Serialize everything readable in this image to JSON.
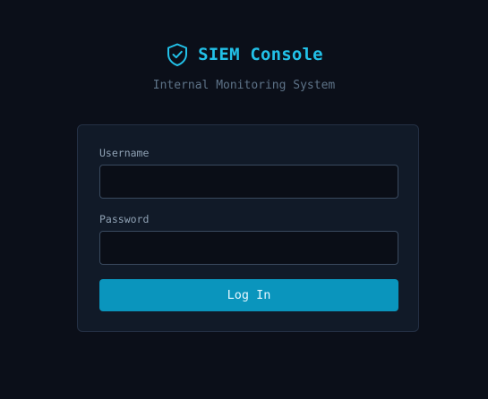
{
  "header": {
    "title": "SIEM Console",
    "subtitle": "Internal Monitoring System",
    "icon": "shield-check-icon"
  },
  "login_form": {
    "username_label": "Username",
    "username_value": "",
    "username_placeholder": "",
    "password_label": "Password",
    "password_value": "",
    "password_placeholder": "",
    "submit_label": "Log In"
  },
  "colors": {
    "background": "#0b0f19",
    "card": "#111a28",
    "accent": "#22c1e8",
    "button": "#0a95bd"
  }
}
